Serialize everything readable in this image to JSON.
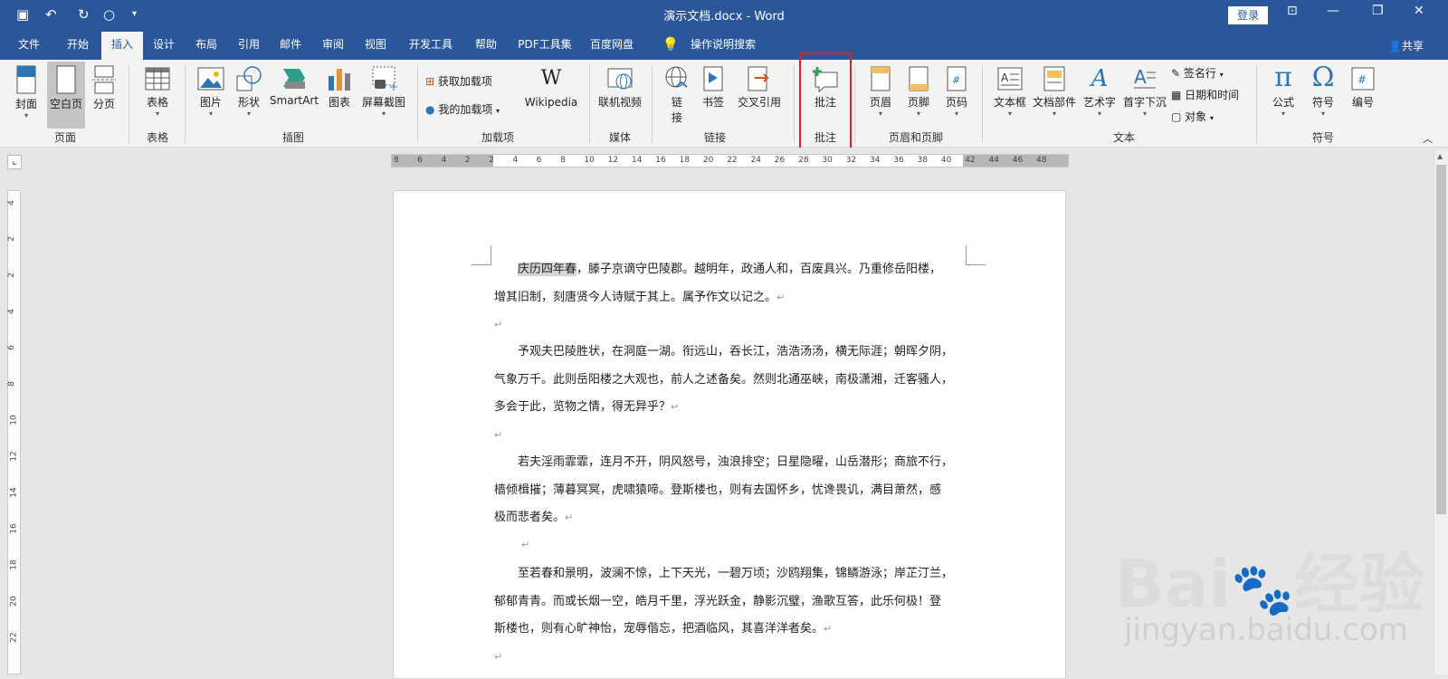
{
  "titlebar": {
    "title": "演示文档.docx - Word",
    "login_label": "登录",
    "share_label": "共享"
  },
  "tabs": [
    "文件",
    "开始",
    "插入",
    "设计",
    "布局",
    "引用",
    "邮件",
    "审阅",
    "视图",
    "开发工具",
    "帮助",
    "PDF工具集",
    "百度网盘"
  ],
  "active_tab": "插入",
  "search_label": "操作说明搜索",
  "ribbon": {
    "pages": {
      "cover": "封面",
      "blank": "空白页",
      "break": "分页",
      "group": "页面"
    },
    "tables": {
      "table": "表格",
      "group": "表格"
    },
    "illustrations": {
      "picture": "图片",
      "shapes": "形状",
      "smartart": "SmartArt",
      "chart": "图表",
      "screenshot": "屏幕截图",
      "group": "插图"
    },
    "addins": {
      "get": "获取加载项",
      "mine": "我的加载项",
      "wikipedia": "Wikipedia",
      "group": "加载项"
    },
    "media": {
      "video": "联机视频",
      "group": "媒体"
    },
    "links": {
      "link_1": "链",
      "link_2": "接",
      "bookmark": "书签",
      "crossref": "交叉引用",
      "group": "链接"
    },
    "comments": {
      "comment": "批注",
      "group": "批注"
    },
    "headerfooter": {
      "header": "页眉",
      "footer": "页脚",
      "pagenum": "页码",
      "group": "页眉和页脚"
    },
    "text": {
      "textbox": "文本框",
      "quickparts": "文档部件",
      "wordart": "艺术字",
      "dropcap": "首字下沉",
      "signature": "签名行",
      "datetime": "日期和时间",
      "object": "对象",
      "group": "文本"
    },
    "symbols": {
      "equation": "公式",
      "symbol": "符号",
      "number": "编号",
      "group": "符号"
    }
  },
  "hruler_numbers": [
    "8",
    "6",
    "4",
    "2",
    "2",
    "4",
    "6",
    "8",
    "10",
    "12",
    "14",
    "16",
    "18",
    "20",
    "22",
    "24",
    "26",
    "28",
    "30",
    "32",
    "34",
    "36",
    "38",
    "40",
    "42",
    "44",
    "46",
    "48"
  ],
  "vruler_numbers": [
    "4",
    "2",
    "2",
    "4",
    "6",
    "8",
    "10",
    "12",
    "14",
    "16",
    "18",
    "20",
    "22"
  ],
  "document": {
    "p1_hl": "庆历四年春",
    "p1_l1": "，滕子京谪守巴陵郡。越明年，政通人和，百废具兴。乃重修岳阳楼，",
    "p1_l2": "增其旧制，刻唐贤今人诗赋于其上。属予作文以记之。",
    "p2_l1": "予观夫巴陵胜状，在洞庭一湖。衔远山，吞长江，浩浩汤汤，横无际涯；朝晖夕阴，",
    "p2_l2": "气象万千。此则岳阳楼之大观也，前人之述备矣。然则北通巫峡，南极潇湘，迁客骚人，",
    "p2_l3": "多会于此，览物之情，得无异乎？",
    "p3_l1": "若夫淫雨霏霏，连月不开，阴风怒号，浊浪排空；日星隐曜，山岳潜形；商旅不行，",
    "p3_l2": "樯倾楫摧；薄暮冥冥，虎啸猿啼。登斯楼也，则有去国怀乡，忧谗畏讥，满目萧然，感",
    "p3_l3": "极而悲者矣。",
    "p4_l1": "至若春和景明，波澜不惊，上下天光，一碧万顷；沙鸥翔集，锦鳞游泳；岸芷汀兰，",
    "p4_l2": "郁郁青青。而或长烟一空，皓月千里，浮光跃金，静影沉璧，渔歌互答，此乐何极！登",
    "p4_l3": "斯楼也，则有心旷神怡，宠辱偕忘，把酒临风，其喜洋洋者矣。",
    "para_mark": "↵"
  },
  "watermark": {
    "brand": "Bai",
    "brand2": "经验",
    "url": "jingyan.baidu.com"
  },
  "colors": {
    "titlebar": "#2b579a",
    "ribbon": "#f3f3f3",
    "highlight_box": "#e02020"
  }
}
